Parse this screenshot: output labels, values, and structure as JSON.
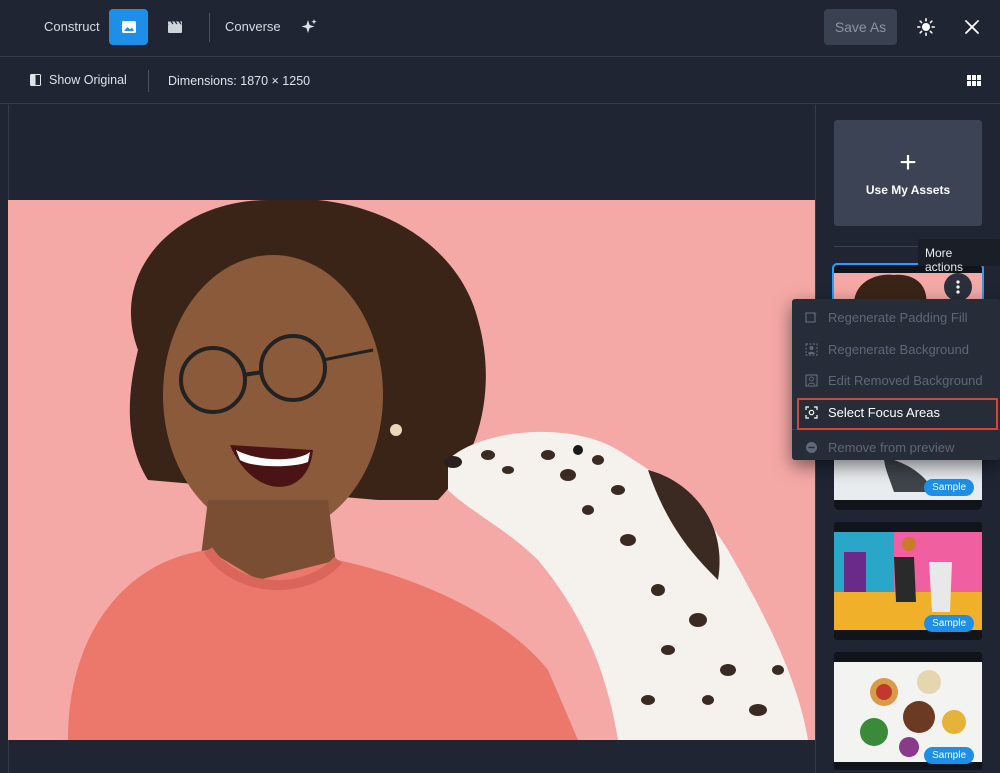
{
  "toolbar": {
    "construct_label": "Construct",
    "converse_label": "Converse",
    "save_as_label": "Save As"
  },
  "subbar": {
    "show_original_label": "Show Original",
    "dimensions_label": "Dimensions: 1870 × 1250"
  },
  "panel": {
    "use_assets_label": "Use My Assets",
    "tooltip": "More actions",
    "thumbnails": [
      {
        "badge": ""
      },
      {
        "badge": "Sample"
      },
      {
        "badge": "Sample"
      },
      {
        "badge": "Sample"
      }
    ]
  },
  "menu": {
    "items": [
      {
        "label": "Regenerate Padding Fill",
        "icon": "padding-fill-icon",
        "enabled": false
      },
      {
        "label": "Regenerate Background",
        "icon": "background-icon",
        "enabled": false
      },
      {
        "label": "Edit Removed Background",
        "icon": "person-background-icon",
        "enabled": false
      },
      {
        "label": "Select Focus Areas",
        "icon": "focus-area-icon",
        "enabled": true
      },
      {
        "label": "Remove from preview",
        "icon": "minus-circle-icon",
        "enabled": false
      }
    ]
  },
  "colors": {
    "accent": "#1e8fe8",
    "background": "#1f2533",
    "photo_bg": "#f5a9a6",
    "highlight": "#e0402f"
  }
}
